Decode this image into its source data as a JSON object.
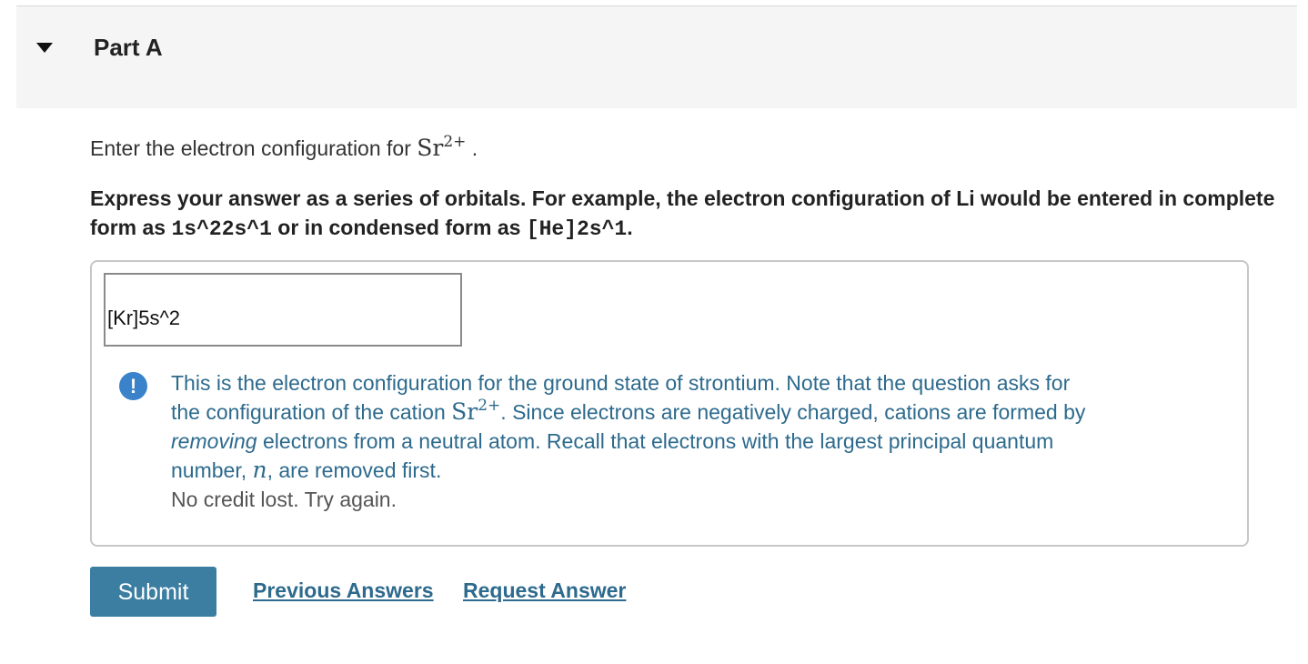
{
  "part": {
    "title": "Part A"
  },
  "question": {
    "prompt_prefix": "Enter the electron configuration for ",
    "species_symbol": "Sr",
    "species_charge": "2+",
    "prompt_suffix": ".",
    "instructions_1": "Express your answer as a series of orbitals. For example, the electron configuration of Li would be entered in complete form as ",
    "example_complete": "1s^22s^1",
    "instructions_2": " or in condensed form as ",
    "example_condensed": "[He]2s^1",
    "instructions_3": "."
  },
  "answer": {
    "value": "[Kr]5s^2"
  },
  "feedback": {
    "icon": "exclamation-icon",
    "icon_glyph": "!",
    "line1": "This is the electron configuration for the ground state of strontium. Note that the question asks for",
    "line2_prefix": "the configuration of the cation ",
    "line2_symbol": "Sr",
    "line2_charge": "2+",
    "line2_suffix": ". Since electrons are negatively charged, cations are formed by",
    "line3_emphasis": "removing",
    "line3_rest": " electrons from a neutral atom. Recall that electrons with the largest principal quantum",
    "line4_prefix": "number, ",
    "line4_var": "n",
    "line4_suffix": ", are removed first.",
    "credit": "No credit lost. Try again."
  },
  "actions": {
    "submit_label": "Submit",
    "previous_answers_label": "Previous Answers",
    "request_answer_label": "Request Answer"
  },
  "colors": {
    "header_bg": "#f5f5f5",
    "feedback_text": "#2d6a8d",
    "submit_bg": "#3b7ea1",
    "icon_bg": "#3a82c9"
  }
}
